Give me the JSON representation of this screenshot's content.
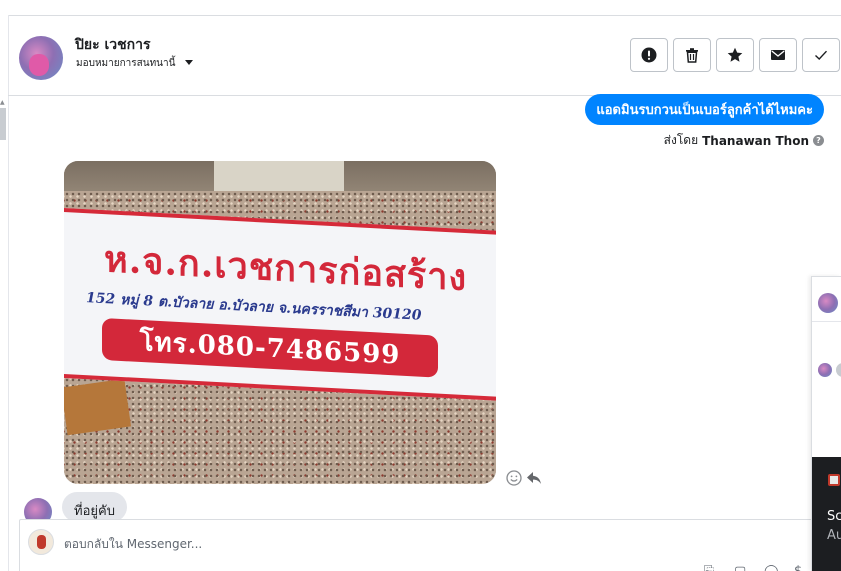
{
  "header": {
    "contact_name": "ปิยะ เวชการ",
    "assign_label": "มอบหมายการสนทนานี้"
  },
  "actions": [
    {
      "name": "spam",
      "icon": "exclamation-icon"
    },
    {
      "name": "delete",
      "icon": "trash-icon"
    },
    {
      "name": "star",
      "icon": "star-icon"
    },
    {
      "name": "unread",
      "icon": "envelope-icon"
    },
    {
      "name": "done",
      "icon": "checkmark-icon"
    }
  ],
  "messages": {
    "sent_text": "แอดมินรบกวนเป็นเบอร์ลูกค้าได้ไหมคะ",
    "sent_by_prefix": "ส่งโดย",
    "sent_by_name": "Thanawan Thon",
    "photo": {
      "sign_title": "ห.จ.ก.เวชการก่อสร้าง",
      "sign_address": "152 หมู่ 8 ต.บัวลาย อ.บัวลาย จ.นครราชสีมา 30120",
      "sign_phone": "โทร.080-7486599"
    },
    "received_text_partial": "ที่อยู่คับ"
  },
  "composer": {
    "placeholder": "ตอบกลับใน Messenger..."
  },
  "right_panel": {
    "text1": "Sc",
    "text2": "Au"
  },
  "colors": {
    "messenger_blue": "#0084ff",
    "sign_red": "#d3283a",
    "sign_blue": "#2a3a8e"
  }
}
